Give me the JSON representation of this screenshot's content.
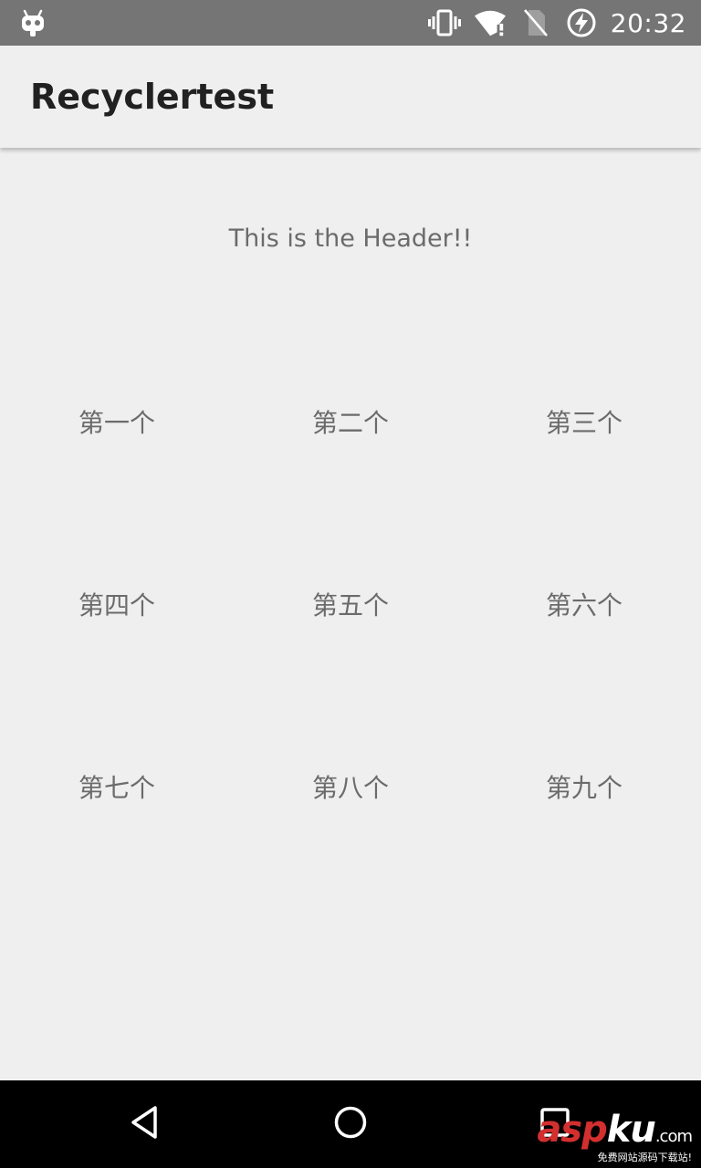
{
  "status_bar": {
    "time": "20:32",
    "icons": [
      "cyanogenmod-bugdroid-icon",
      "vibrate-icon",
      "wifi-no-internet-icon",
      "no-sim-icon",
      "battery-charging-icon"
    ]
  },
  "app_bar": {
    "title": "Recyclertest"
  },
  "content": {
    "header": "This is the Header!!",
    "items": [
      "第一个",
      "第二个",
      "第三个",
      "第四个",
      "第五个",
      "第六个",
      "第七个",
      "第八个",
      "第九个"
    ]
  },
  "nav_bar": {
    "icons": [
      "back-icon",
      "home-icon",
      "recents-icon"
    ]
  },
  "watermark": {
    "brand_a": "asp",
    "brand_b": "ku",
    "brand_c": ".com",
    "tagline": "免费网站源码下载站!"
  },
  "colors": {
    "status_bar": "#757575",
    "background": "#efefef",
    "title_text": "#212121",
    "item_text": "#6b6b6b",
    "nav_bar": "#000000",
    "watermark_red": "#d32f2f"
  }
}
